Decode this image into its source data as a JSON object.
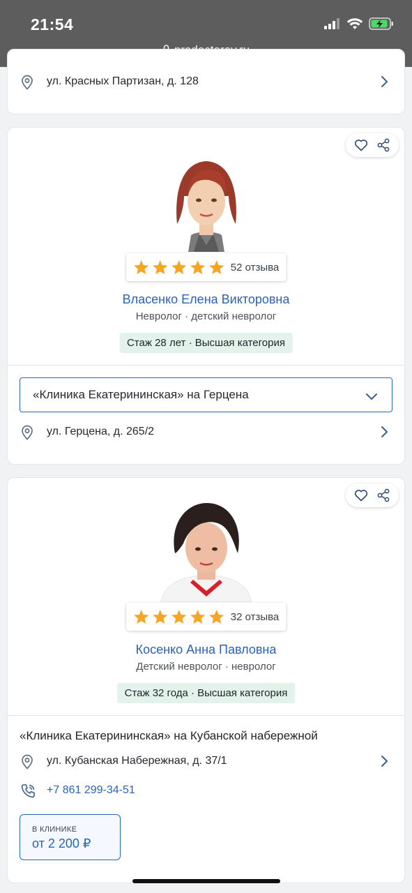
{
  "status_bar": {
    "time": "21:54",
    "url": "prodoctorov.ru"
  },
  "top_card": {
    "address": "ул. Красных Партизан, д. 128"
  },
  "doctors": [
    {
      "name": "Власенко Елена Викторовна",
      "specialty": "Невролог · детский невролог",
      "rating_stars": 5,
      "reviews": "52 отзыва",
      "experience": "Стаж 28 лет",
      "category": " · Высшая категория",
      "clinic": "«Клиника Екатерининская» на Герцена",
      "address": "ул. Герцена, д. 265/2"
    },
    {
      "name": "Косенко Анна Павловна",
      "specialty": "Детский невролог · невролог",
      "rating_stars": 5,
      "reviews": "32 отзыва",
      "experience": "Стаж 32 года",
      "category": " · Высшая категория",
      "clinic": "«Клиника Екатерининская» на Кубанской набережной",
      "address": "ул. Кубанская Набережная, д. 37/1",
      "phone": "+7 861 299-34-51",
      "price_label": "В КЛИНИКЕ",
      "price_value": "от 2 200 ₽"
    }
  ],
  "colors": {
    "accent": "#2b63b7",
    "star": "#f6a623",
    "badge_bg": "#e3f3ec"
  }
}
